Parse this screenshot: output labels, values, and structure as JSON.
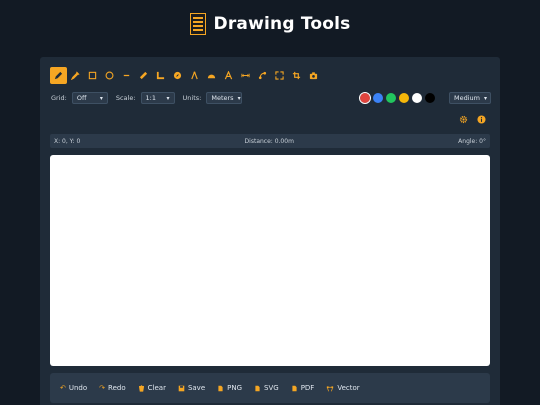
{
  "header": {
    "title": "Drawing Tools",
    "logo_icon": "easel-logo"
  },
  "colors": {
    "accent": "#f5a623",
    "background": "#121a24",
    "panel": "#1f2b38",
    "canvas": "#ffffff"
  },
  "toolbar": {
    "tools": [
      {
        "name": "pencil-tool",
        "icon": "pencil-icon",
        "active": true
      },
      {
        "name": "marker-tool",
        "icon": "marker-icon"
      },
      {
        "name": "rectangle-tool",
        "icon": "square-icon"
      },
      {
        "name": "circle-tool",
        "icon": "circle-icon"
      },
      {
        "name": "line-tool",
        "icon": "line-icon"
      },
      {
        "name": "ruler-tool",
        "icon": "ruler-icon"
      },
      {
        "name": "angle-tool",
        "icon": "l-ruler-icon"
      },
      {
        "name": "compass-tool",
        "icon": "compass-icon"
      },
      {
        "name": "drafting-compass-tool",
        "icon": "drafting-compass-icon"
      },
      {
        "name": "protractor-tool",
        "icon": "protractor-icon"
      },
      {
        "name": "text-tool",
        "icon": "text-a-icon"
      },
      {
        "name": "dimension-tool",
        "icon": "arrows-h-icon"
      },
      {
        "name": "vector-tool",
        "icon": "bezier-icon"
      },
      {
        "name": "expand-tool",
        "icon": "expand-icon"
      },
      {
        "name": "crop-tool",
        "icon": "crop-icon"
      },
      {
        "name": "camera-tool",
        "icon": "camera-icon"
      }
    ]
  },
  "options": {
    "grid_label": "Grid:",
    "grid_value": "Off",
    "scale_label": "Scale:",
    "scale_value": "1:1",
    "units_label": "Units:",
    "units_value": "Meters",
    "size_value": "Medium",
    "swatches": [
      {
        "name": "red",
        "color": "#e0443e",
        "selected": true
      },
      {
        "name": "blue",
        "color": "#3b82f6"
      },
      {
        "name": "green",
        "color": "#22c55e"
      },
      {
        "name": "yellow",
        "color": "#f5b70a"
      },
      {
        "name": "white",
        "color": "#ffffff"
      },
      {
        "name": "black",
        "color": "#000000"
      }
    ]
  },
  "side_icons": [
    "gear-icon",
    "info-icon"
  ],
  "status": {
    "coords": "X: 0, Y: 0",
    "distance": "Distance: 0.00m",
    "angle": "Angle: 0°"
  },
  "actions": {
    "undo": "Undo",
    "redo": "Redo",
    "clear": "Clear",
    "save": "Save",
    "png": "PNG",
    "svg": "SVG",
    "pdf": "PDF",
    "vector": "Vector"
  }
}
